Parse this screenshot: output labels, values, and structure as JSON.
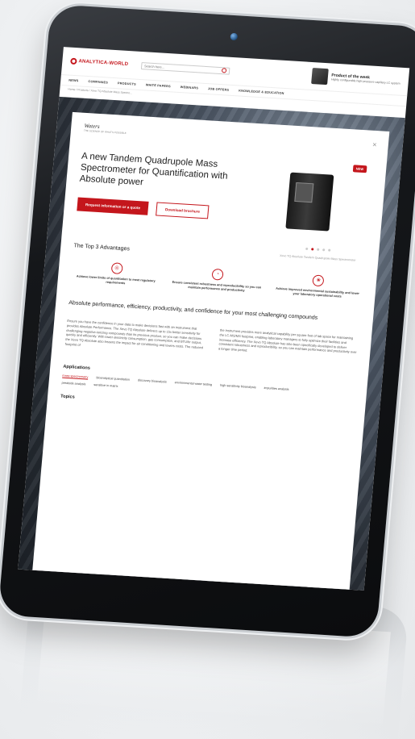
{
  "header": {
    "logo": "ANALYTICA-WORLD",
    "search_placeholder": "Search here...",
    "potw_title": "Product of the week",
    "potw_sub": "Highly configurable high-pressure capillary LC system"
  },
  "nav": [
    "NEWS",
    "COMPANIES",
    "PRODUCTS",
    "WHITE PAPERS",
    "WEBINARS",
    "JOB OFFERS",
    "KNOWLEDGE & EDUCATION"
  ],
  "breadcrumb": "Home / Products / Xevo TQ Absolute Mass Spectro...",
  "product": {
    "brand": "Waters",
    "brand_sub": "THE SCIENCE OF WHAT'S POSSIBLE",
    "title": "A new Tandem Quadrupole Mass Spectrometer for Quantification with Absolute power",
    "btn_request": "Request information or a quote",
    "btn_download": "Download brochure",
    "badge": "NEW",
    "caption": "Xevo TQ Absolute Tandem Quadrupole Mass Spectrometer"
  },
  "advantages": {
    "heading": "The Top 3 Advantages",
    "items": [
      "Achieve lower limits of quantitation to meet regulatory requirements",
      "Ensure consistent robustness and reproducibility so you can maintain performance and productivity",
      "Achieve improved environmental sustainability and lower your laboratory operational costs"
    ]
  },
  "section": {
    "heading": "Absolute performance, efficiency, productivity, and confidence for your most challenging compounds",
    "col1": "Ensure you have the confidence in your data to make decisions fast with an instrument that provides Absolute Performance. The Xevo TQ Absolute delivers up to 15x better sensitivity for challenging negative-ionizing compounds than its previous product, so you can make decisions quickly and efficiently. With lower electricity consumption, gas consumption, and BTU/hr output, the Xevo TQ Absolute also lessens the impact for air conditioning and lowers costs. The reduced footprint of",
    "col2": "the instrument provides more analytical capability per square foot of lab space for maintaining the LC-MS/MS footprint, enabling laboratory managers to fully optimize their facilities and increase efficiency. The Xevo TQ Absolute has also been specifically developed to deliver consistent robustness and reproducibility, so you can maintain performance and productivity over a longer time period."
  },
  "applications": {
    "title": "Applications",
    "tags": [
      "mass spectrometry",
      "bioanalytical quantitation",
      "discovery bioanalysis",
      "environmental water testing",
      "high sensitivity bioanalysis",
      "impurities analysis",
      "pesticide analysis",
      "sensitive in matrix"
    ]
  },
  "topics_title": "Topics"
}
